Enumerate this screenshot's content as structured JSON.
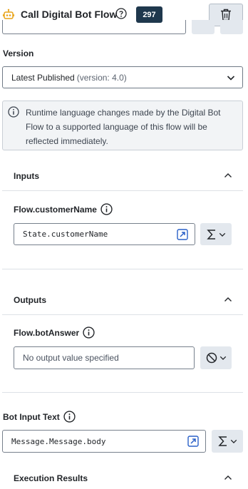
{
  "header": {
    "title": "Call Digital Bot Flow",
    "count": "297"
  },
  "version": {
    "label": "Version",
    "selected_main": "Latest Published",
    "selected_detail": "(version: 4.0)"
  },
  "info": {
    "text": "Runtime language changes made by the Digital Bot Flow to a supported language of this flow will be reflected immediately."
  },
  "inputs": {
    "title": "Inputs",
    "field_label": "Flow.customerName",
    "value": "State.customerName"
  },
  "outputs": {
    "title": "Outputs",
    "field_label": "Flow.botAnswer",
    "placeholder": "No output value specified"
  },
  "bot_input": {
    "label": "Bot Input Text",
    "value": "Message.Message.body"
  },
  "execution": {
    "title": "Execution Results"
  },
  "colors": {
    "accent": "#2a60c8",
    "badge": "#1f384d",
    "bot_icon": "#e8a317"
  }
}
